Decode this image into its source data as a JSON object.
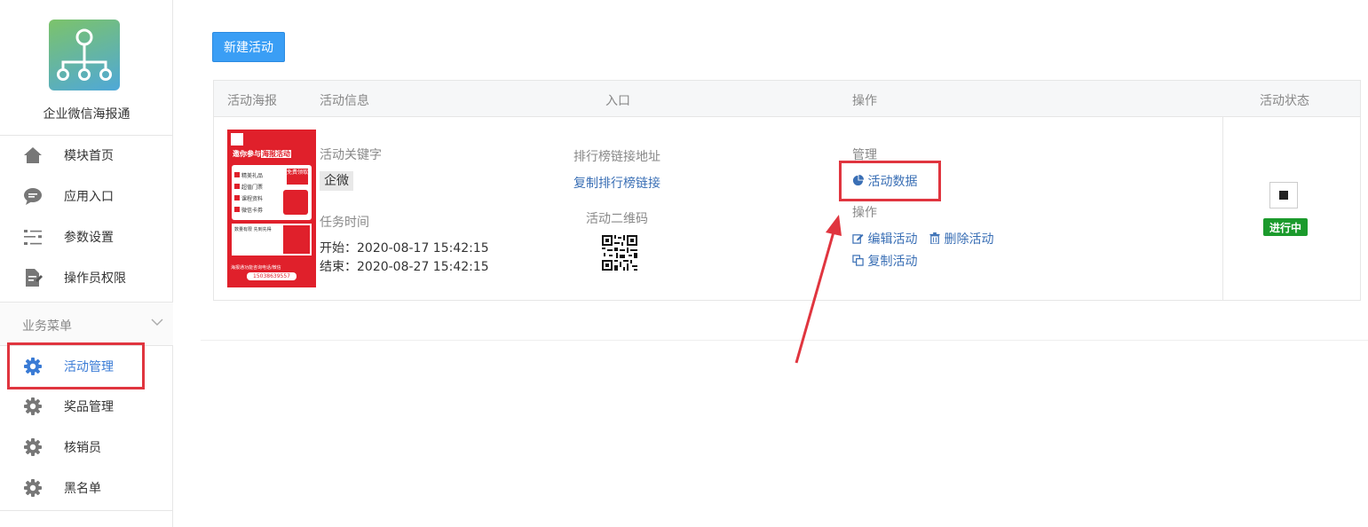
{
  "app": {
    "name": "企业微信海报通"
  },
  "sidebar": {
    "items": [
      {
        "label": "模块首页",
        "icon": "home-icon"
      },
      {
        "label": "应用入口",
        "icon": "chat-bubble-icon"
      },
      {
        "label": "参数设置",
        "icon": "sliders-icon"
      },
      {
        "label": "操作员权限",
        "icon": "document-edit-icon"
      }
    ],
    "group": {
      "label": "业务菜单"
    },
    "group_items": [
      {
        "label": "活动管理",
        "icon": "gear-icon",
        "active": true
      },
      {
        "label": "奖品管理",
        "icon": "gear-icon"
      },
      {
        "label": "核销员",
        "icon": "gear-icon"
      },
      {
        "label": "黑名单",
        "icon": "gear-icon"
      }
    ]
  },
  "toolbar": {
    "new_label": "新建活动"
  },
  "table": {
    "headers": [
      "活动海报",
      "活动信息",
      "入口",
      "操作",
      "活动状态"
    ],
    "row": {
      "poster": {
        "headline": "邀你参与",
        "headline_hl": "海报活动",
        "badge": "免费领取",
        "items": [
          "精美礼品",
          "超值门票",
          "课程资料",
          "微信卡券"
        ],
        "footer1": "数量有限 先到先得",
        "footer2": "海报通功能咨询电话/微信",
        "phone": "15038639557"
      },
      "keyword_label": "活动关键字",
      "keyword": "企微",
      "time_label": "任务时间",
      "start": "开始：2020-08-17 15:42:15",
      "end": "结束：2020-08-27 15:42:15",
      "rank_label": "排行榜链接地址",
      "rank_link": "复制排行榜链接",
      "qr_label": "活动二维码",
      "manage_label": "管理",
      "data_link": "活动数据",
      "ops_label": "操作",
      "edit_link": "编辑活动",
      "delete_link": "删除活动",
      "copy_link": "复制活动",
      "status": "进行中"
    }
  },
  "colors": {
    "accent": "#3a9ef5",
    "highlight": "#e0353f",
    "status": "#1b9a2c",
    "link": "#3a6fb5"
  }
}
